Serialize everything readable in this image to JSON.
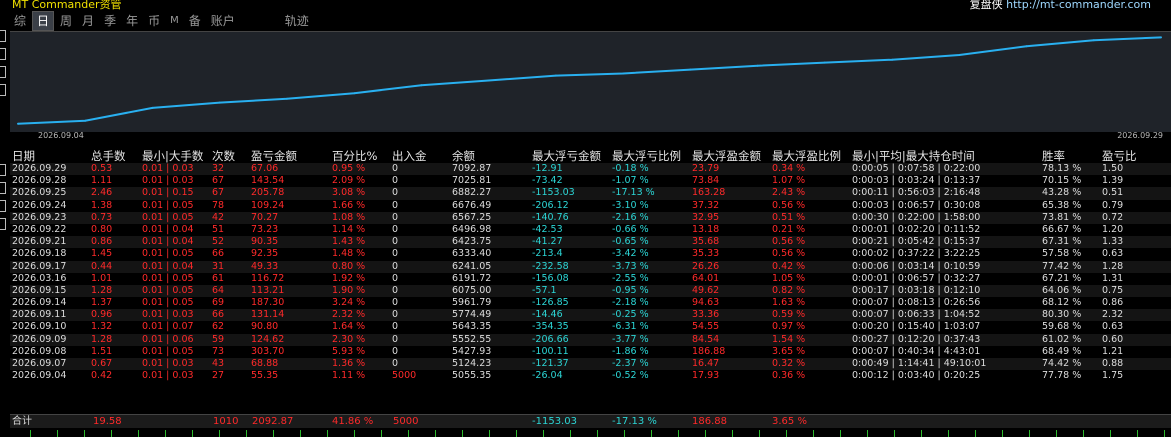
{
  "app": {
    "title_left": "MT Commander资管",
    "title_right_label": "复盘侠",
    "title_right_url": "http://mt-commander.com"
  },
  "tabs": [
    "综",
    "日",
    "周",
    "月",
    "季",
    "年",
    "币",
    "M",
    "备",
    "账户",
    "轨迹"
  ],
  "active_tab": "日",
  "chart": {
    "start_date": "2026.09.04",
    "end_date": "2026.09.29"
  },
  "chart_data": {
    "type": "line",
    "categories": [
      "2026.09.04",
      "2026.09.07",
      "2026.09.08",
      "2026.09.09",
      "2026.09.10",
      "2026.09.11",
      "2026.09.14",
      "2026.09.15",
      "2026.03.16",
      "2026.09.17",
      "2026.09.18",
      "2026.09.21",
      "2026.09.22",
      "2026.09.23",
      "2026.09.24",
      "2026.09.25",
      "2026.09.28",
      "2026.09.29"
    ],
    "series": [
      {
        "values": [
          5055.35,
          5124.23,
          5427.93,
          5552.55,
          5643.35,
          5774.49,
          5961.79,
          6075.0,
          6191.72,
          6241.05,
          6333.4,
          6423.75,
          6496.98,
          6567.25,
          6676.49,
          6882.27,
          7025.81,
          7092.87
        ]
      }
    ],
    "color": "#29b0f0"
  },
  "headers": [
    "日期",
    "总手数",
    "最小|大手数",
    "次数",
    "盈亏金额",
    "百分比%",
    "出入金",
    "余额",
    "最大浮亏金额",
    "最大浮亏比例",
    "最大浮盈金额",
    "最大浮盈比例",
    "最小|平均|最大持仓时间",
    "胜率",
    "盈亏比"
  ],
  "rows": [
    [
      "2026.09.29",
      "0.53",
      "0.01 | 0.03",
      "32",
      "67.06",
      "0.95 %",
      "0",
      "7092.87",
      "-12.91",
      "-0.18 %",
      "23.79",
      "0.34 %",
      "0:00:05 | 0:07:58 | 0:22:00",
      "78.13 %",
      "1.50"
    ],
    [
      "2026.09.28",
      "1.11",
      "0.01 | 0.03",
      "67",
      "143.54",
      "2.09 %",
      "0",
      "7025.81",
      "-73.42",
      "-1.07 %",
      "73.84",
      "1.07 %",
      "0:00:03 | 0:03:24 | 0:13:37",
      "70.15 %",
      "1.39"
    ],
    [
      "2026.09.25",
      "2.46",
      "0.01 | 0.15",
      "67",
      "205.78",
      "3.08 %",
      "0",
      "6882.27",
      "-1153.03",
      "-17.13 %",
      "163.28",
      "2.43 %",
      "0:00:11 | 0:56:03 | 2:16:48",
      "43.28 %",
      "0.51"
    ],
    [
      "2026.09.24",
      "1.38",
      "0.01 | 0.05",
      "78",
      "109.24",
      "1.66 %",
      "0",
      "6676.49",
      "-206.12",
      "-3.10 %",
      "37.32",
      "0.56 %",
      "0:00:03 | 0:06:57 | 0:30:08",
      "65.38 %",
      "0.79"
    ],
    [
      "2026.09.23",
      "0.73",
      "0.01 | 0.05",
      "42",
      "70.27",
      "1.08 %",
      "0",
      "6567.25",
      "-140.76",
      "-2.16 %",
      "32.95",
      "0.51 %",
      "0:00:30 | 0:22:00 | 1:58:00",
      "73.81 %",
      "0.72"
    ],
    [
      "2026.09.22",
      "0.80",
      "0.01 | 0.04",
      "51",
      "73.23",
      "1.14 %",
      "0",
      "6496.98",
      "-42.53",
      "-0.66 %",
      "13.18",
      "0.21 %",
      "0:00:01 | 0:02:20 | 0:11:52",
      "66.67 %",
      "1.20"
    ],
    [
      "2026.09.21",
      "0.86",
      "0.01 | 0.04",
      "52",
      "90.35",
      "1.43 %",
      "0",
      "6423.75",
      "-41.27",
      "-0.65 %",
      "35.68",
      "0.56 %",
      "0:00:21 | 0:05:42 | 0:15:37",
      "67.31 %",
      "1.33"
    ],
    [
      "2026.09.18",
      "1.45",
      "0.01 | 0.05",
      "66",
      "92.35",
      "1.48 %",
      "0",
      "6333.40",
      "-213.4",
      "-3.42 %",
      "35.33",
      "0.56 %",
      "0:00:02 | 0:37:22 | 3:22:25",
      "57.58 %",
      "0.63"
    ],
    [
      "2026.09.17",
      "0.44",
      "0.01 | 0.04",
      "31",
      "49.33",
      "0.80 %",
      "0",
      "6241.05",
      "-232.58",
      "-3.73 %",
      "26.26",
      "0.42 %",
      "0:00:06 | 0:03:14 | 0:10:59",
      "77.42 %",
      "1.28"
    ],
    [
      "2026.03.16",
      "1.01",
      "0.01 | 0.05",
      "61",
      "116.72",
      "1.92 %",
      "0",
      "6191.72",
      "-156.08",
      "-2.55 %",
      "64.01",
      "1.05 %",
      "0:00:01 | 0:06:57 | 0:32:27",
      "67.21 %",
      "1.31"
    ],
    [
      "2026.09.15",
      "1.28",
      "0.01 | 0.05",
      "64",
      "113.21",
      "1.90 %",
      "0",
      "6075.00",
      "-57.1",
      "-0.95 %",
      "49.62",
      "0.82 %",
      "0:00:17 | 0:03:18 | 0:12:10",
      "64.06 %",
      "0.75"
    ],
    [
      "2026.09.14",
      "1.37",
      "0.01 | 0.05",
      "69",
      "187.30",
      "3.24 %",
      "0",
      "5961.79",
      "-126.85",
      "-2.18 %",
      "94.63",
      "1.63 %",
      "0:00:07 | 0:08:13 | 0:26:56",
      "68.12 %",
      "0.86"
    ],
    [
      "2026.09.11",
      "0.96",
      "0.01 | 0.03",
      "66",
      "131.14",
      "2.32 %",
      "0",
      "5774.49",
      "-14.46",
      "-0.25 %",
      "33.36",
      "0.59 %",
      "0:00:07 | 0:06:33 | 1:04:52",
      "80.30 %",
      "2.32"
    ],
    [
      "2026.09.10",
      "1.32",
      "0.01 | 0.07",
      "62",
      "90.80",
      "1.64 %",
      "0",
      "5643.35",
      "-354.35",
      "-6.31 %",
      "54.55",
      "0.97 %",
      "0:00:20 | 0:15:40 | 1:03:07",
      "59.68 %",
      "0.63"
    ],
    [
      "2026.09.09",
      "1.28",
      "0.01 | 0.06",
      "59",
      "124.62",
      "2.30 %",
      "0",
      "5552.55",
      "-206.66",
      "-3.77 %",
      "84.54",
      "1.54 %",
      "0:00:27 | 0:12:20 | 0:37:43",
      "61.02 %",
      "0.60"
    ],
    [
      "2026.09.08",
      "1.51",
      "0.01 | 0.05",
      "73",
      "303.70",
      "5.93 %",
      "0",
      "5427.93",
      "-100.11",
      "-1.86 %",
      "186.88",
      "3.65 %",
      "0:00:07 | 0:40:34 | 4:43:01",
      "68.49 %",
      "1.21"
    ],
    [
      "2026.09.07",
      "0.67",
      "0.01 | 0.03",
      "43",
      "68.88",
      "1.36 %",
      "0",
      "5124.23",
      "-121.37",
      "-2.37 %",
      "16.47",
      "0.32 %",
      "0:00:49 | 1:14:41 | 49:10:01",
      "74.42 %",
      "0.88"
    ],
    [
      "2026.09.04",
      "0.42",
      "0.01 | 0.03",
      "27",
      "55.35",
      "1.11 %",
      "5000",
      "5055.35",
      "-26.04",
      "-0.52 %",
      "17.93",
      "0.36 %",
      "0:00:12 | 0:03:40 | 0:20:25",
      "77.78 %",
      "1.75"
    ]
  ],
  "totals": {
    "label": "合计",
    "lots": "19.58",
    "count": "1010",
    "pnl": "2092.87",
    "pct": "41.86 %",
    "flow": "5000",
    "max_float_loss": "-1153.03",
    "max_float_loss_pct": "-17.13 %",
    "max_float_profit": "186.88",
    "max_float_profit_pct": "3.65 %"
  }
}
